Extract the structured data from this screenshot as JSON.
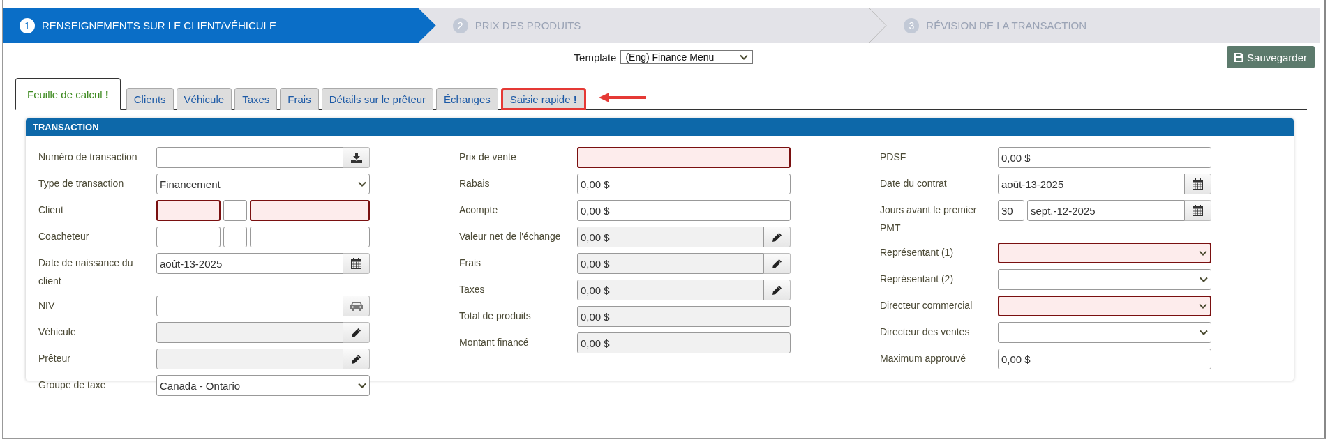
{
  "wizard": {
    "steps": [
      {
        "number": "1",
        "label": "RENSEIGNEMENTS SUR LE CLIENT/VÉHICULE",
        "selected": true
      },
      {
        "number": "2",
        "label": "PRIX DES PRODUITS",
        "selected": false
      },
      {
        "number": "3",
        "label": "RÉVISION DE LA TRANSACTION",
        "selected": false
      }
    ]
  },
  "template": {
    "label": "Template",
    "value": "(Eng) Finance Menu"
  },
  "save_button": "Sauvegarder",
  "tabs": [
    {
      "label": "Feuille de calcul **!**",
      "selected": true,
      "highlighted": false
    },
    {
      "label": "Clients",
      "selected": false,
      "highlighted": false
    },
    {
      "label": "Véhicule",
      "selected": false,
      "highlighted": false
    },
    {
      "label": "Taxes",
      "selected": false,
      "highlighted": false
    },
    {
      "label": "Frais",
      "selected": false,
      "highlighted": false
    },
    {
      "label": "Détails sur le prêteur",
      "selected": false,
      "highlighted": false
    },
    {
      "label": "Échanges",
      "selected": false,
      "highlighted": false
    },
    {
      "label": "Saisie rapide **!**",
      "selected": false,
      "highlighted": true
    }
  ],
  "panel": {
    "title": "TRANSACTION",
    "columns": [
      [
        {
          "label": "Numéro de transaction",
          "inputs": [
            {
              "kind": "text",
              "required": false,
              "readonly": false
            }
          ],
          "addon": {
            "kind": "download"
          }
        },
        {
          "label": "Type de transaction",
          "inputs": [
            {
              "kind": "select",
              "value": "Financement",
              "required": false
            }
          ]
        },
        {
          "label": "Client",
          "inputs": [
            {
              "kind": "text",
              "required": true,
              "readonly": false
            },
            {
              "kind": "text",
              "required": false,
              "readonly": false
            },
            {
              "kind": "text",
              "required": true,
              "readonly": false
            }
          ]
        },
        {
          "label": "Coacheteur",
          "inputs": [
            {
              "kind": "text",
              "required": false,
              "readonly": false
            },
            {
              "kind": "text",
              "required": false,
              "readonly": false
            },
            {
              "kind": "text",
              "required": false,
              "readonly": false
            }
          ]
        },
        {
          "label": "Date de naissance du client",
          "inputs": [
            {
              "kind": "text",
              "value": "août-13-2025",
              "required": false,
              "readonly": false
            }
          ],
          "addon": {
            "kind": "calendar"
          }
        },
        {
          "label": "NIV",
          "inputs": [
            {
              "kind": "text",
              "required": false,
              "readonly": false
            }
          ],
          "addon": {
            "kind": "car"
          }
        },
        {
          "label": "Véhicule",
          "inputs": [
            {
              "kind": "text",
              "required": false,
              "readonly": true
            }
          ],
          "addon": {
            "kind": "edit"
          }
        },
        {
          "label": "Prêteur",
          "inputs": [
            {
              "kind": "text",
              "required": false,
              "readonly": true
            }
          ],
          "addon": {
            "kind": "edit"
          }
        },
        {
          "label": "Groupe de taxe",
          "inputs": [
            {
              "kind": "select",
              "value": "Canada - Ontario",
              "required": false
            }
          ]
        }
      ],
      [
        {
          "label": "Prix de vente",
          "inputs": [
            {
              "kind": "text",
              "required": true,
              "readonly": false
            }
          ]
        },
        {
          "label": "Rabais",
          "inputs": [
            {
              "kind": "text",
              "value": "0,00 $",
              "required": false,
              "readonly": false
            }
          ]
        },
        {
          "label": "Acompte",
          "inputs": [
            {
              "kind": "text",
              "value": "0,00 $",
              "required": false,
              "readonly": false
            }
          ]
        },
        {
          "label": "Valeur net de l'échange",
          "inputs": [
            {
              "kind": "text",
              "value": "0,00 $",
              "required": false,
              "readonly": true
            }
          ],
          "addon": {
            "kind": "edit"
          }
        },
        {
          "label": "Frais",
          "inputs": [
            {
              "kind": "text",
              "value": "0,00 $",
              "required": false,
              "readonly": true
            }
          ],
          "addon": {
            "kind": "edit"
          }
        },
        {
          "label": "Taxes",
          "inputs": [
            {
              "kind": "text",
              "value": "0,00 $",
              "required": false,
              "readonly": true
            }
          ],
          "addon": {
            "kind": "edit"
          }
        },
        {
          "label": "Total de produits",
          "inputs": [
            {
              "kind": "text",
              "value": "0,00 $",
              "required": false,
              "readonly": true
            }
          ]
        },
        {
          "label": "Montant financé",
          "inputs": [
            {
              "kind": "text",
              "value": "0,00 $",
              "required": false,
              "readonly": true
            }
          ]
        }
      ],
      [
        {
          "label": "PDSF",
          "inputs": [
            {
              "kind": "text",
              "value": "0,00 $",
              "required": false,
              "readonly": false
            }
          ]
        },
        {
          "label": "Date du contrat",
          "inputs": [
            {
              "kind": "text",
              "value": "août-13-2025",
              "required": false,
              "readonly": false
            }
          ],
          "addon": {
            "kind": "calendar"
          }
        },
        {
          "label": "Jours avant le premier PMT",
          "inputs": [
            {
              "kind": "text",
              "value": "30",
              "required": false,
              "readonly": false
            },
            {
              "kind": "text",
              "value": "sept.-12-2025",
              "required": false,
              "readonly": false
            }
          ],
          "addon": {
            "kind": "calendar"
          }
        },
        {
          "label": "Représentant (1)",
          "inputs": [
            {
              "kind": "select",
              "required": true
            }
          ]
        },
        {
          "label": "Représentant (2)",
          "inputs": [
            {
              "kind": "select",
              "required": false
            }
          ]
        },
        {
          "label": "Directeur commercial",
          "inputs": [
            {
              "kind": "select",
              "required": true
            }
          ]
        },
        {
          "label": "Directeur des ventes",
          "inputs": [
            {
              "kind": "select",
              "required": false
            }
          ]
        },
        {
          "label": "Maximum approuvé",
          "inputs": [
            {
              "kind": "text",
              "value": "0,00 $",
              "required": false,
              "readonly": false
            }
          ]
        }
      ]
    ]
  }
}
